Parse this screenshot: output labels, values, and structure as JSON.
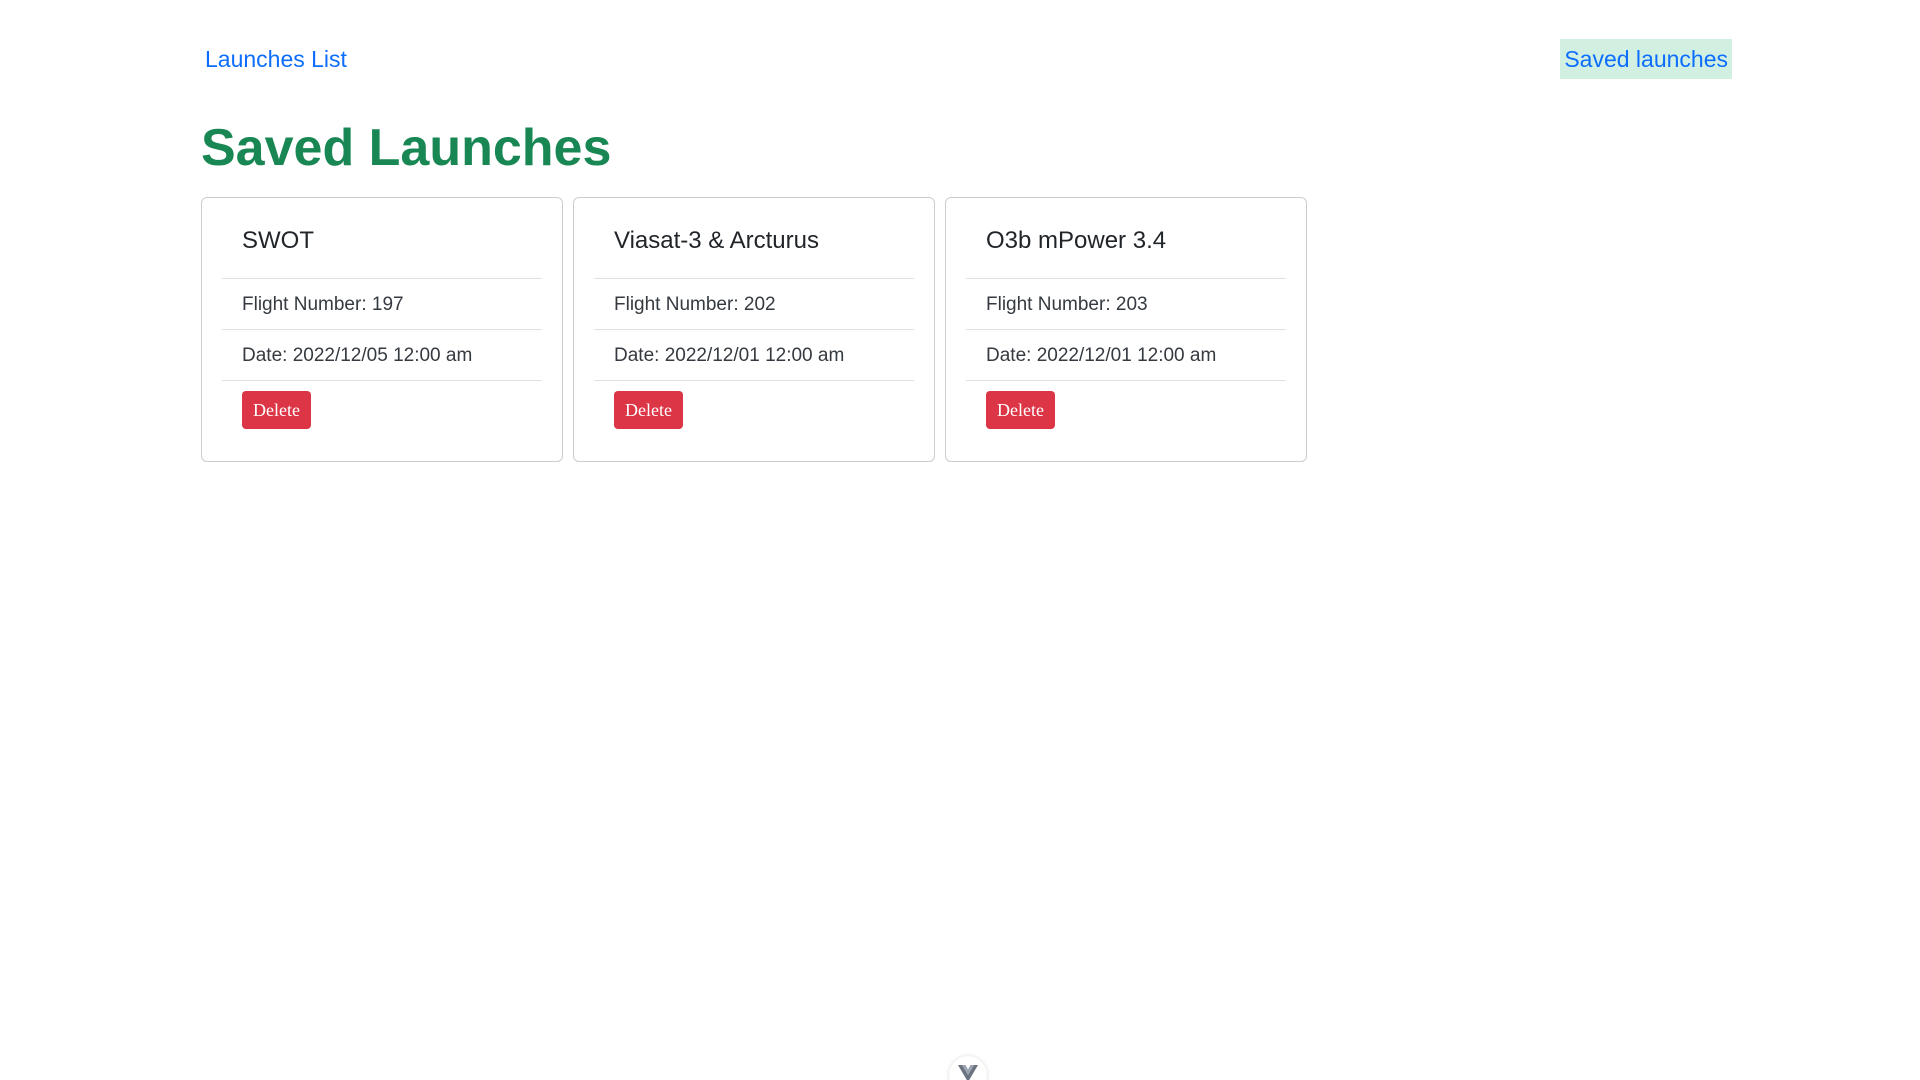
{
  "nav": {
    "launches_list": "Launches List",
    "saved_launches": "Saved launches"
  },
  "page": {
    "title": "Saved Launches"
  },
  "launches": [
    {
      "name": "SWOT",
      "flight_number": "Flight Number: 197",
      "date": "Date: 2022/12/05 12:00 am",
      "delete_label": "Delete"
    },
    {
      "name": "Viasat-3 & Arcturus",
      "flight_number": "Flight Number: 202",
      "date": "Date: 2022/12/01 12:00 am",
      "delete_label": "Delete"
    },
    {
      "name": "O3b mPower 3.4",
      "flight_number": "Flight Number: 203",
      "date": "Date: 2022/12/01 12:00 am",
      "delete_label": "Delete"
    }
  ],
  "devtools": {
    "icon": "vue-logo-icon"
  },
  "colors": {
    "link": "#0d6efd",
    "title": "#198754",
    "active_nav_bg": "#d1f0e2",
    "danger": "#dc3545"
  }
}
